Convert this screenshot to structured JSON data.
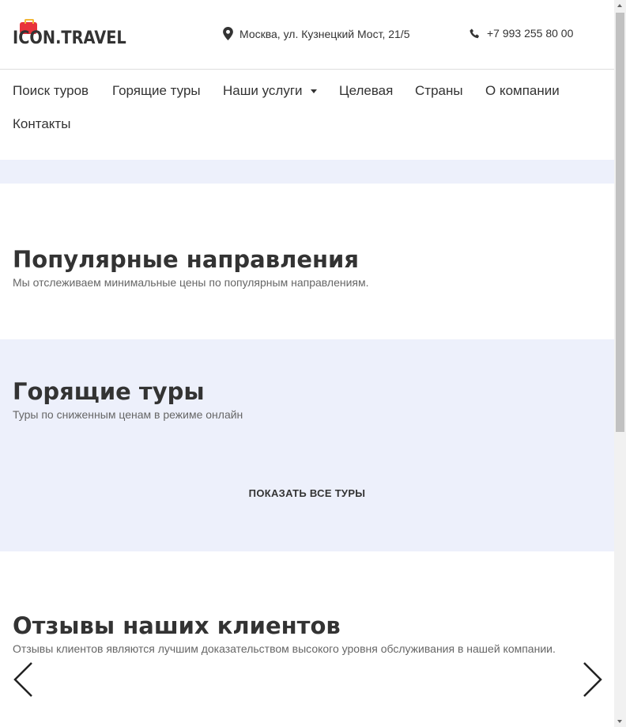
{
  "header": {
    "logo_text": "ICON.TRAVEL",
    "address": "Москва, ул. Кузнецкий Мост, 21/5",
    "phone": "+7 993 255 80 00"
  },
  "nav": [
    "Поиск туров",
    "Горящие туры",
    "Наши услуги",
    "Целевая",
    "Страны",
    "О компании",
    "Контакты"
  ],
  "popular": {
    "title": "Популярные направления",
    "subtitle": "Мы отслеживаем минимальные цены по популярным направлениям."
  },
  "hot": {
    "title": "Горящие туры",
    "subtitle": "Туры по сниженным ценам в режиме онлайн",
    "button": "ПОКАЗАТЬ ВСЕ ТУРЫ"
  },
  "reviews": {
    "title": "Отзывы наших клиентов",
    "subtitle": "Отзывы клиентов являются лучшим доказательством высокого уровня обслуживания в нашей компании."
  },
  "colors": {
    "band": "#edf0fb",
    "logo_red": "#e8333b"
  }
}
